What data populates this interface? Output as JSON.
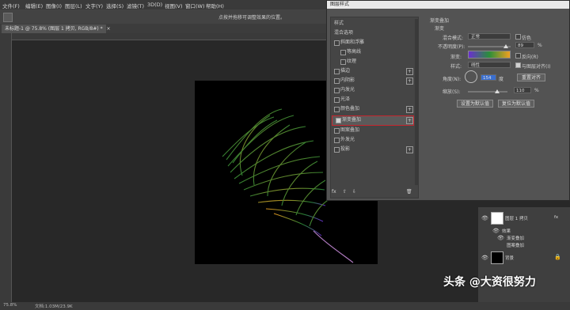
{
  "menubar": {
    "items": [
      "文件(F)",
      "编辑(E)",
      "图像(I)",
      "图层(L)",
      "文字(Y)",
      "选择(S)",
      "滤镜(T)",
      "3D(D)",
      "视图(V)",
      "窗口(W)",
      "帮助(H)"
    ]
  },
  "optionsbar": {
    "hint": "点按并拖移可调整效果的位置。"
  },
  "document": {
    "tab_title": "未标题-1 @ 75.8% (图层 1 拷贝, RGB/8#) *",
    "tab_close": "×"
  },
  "statusbar": {
    "zoom": "75.8%",
    "doc_info": "文档:1.03M/23.9K"
  },
  "dialog": {
    "title": "图层样式",
    "left_list": {
      "styles_label": "样式",
      "blend_label": "混合选项",
      "items": [
        {
          "label": "斜面和浮雕",
          "checked": false,
          "plus": ""
        },
        {
          "label": "等高线",
          "checked": false,
          "plus": ""
        },
        {
          "label": "纹理",
          "checked": false,
          "plus": ""
        },
        {
          "label": "描边",
          "checked": false,
          "plus": "+"
        },
        {
          "label": "内阴影",
          "checked": false,
          "plus": "+"
        },
        {
          "label": "内发光",
          "checked": false,
          "plus": ""
        },
        {
          "label": "光泽",
          "checked": false,
          "plus": ""
        },
        {
          "label": "颜色叠加",
          "checked": false,
          "plus": "+"
        },
        {
          "label": "渐变叠加",
          "checked": true,
          "plus": "+"
        },
        {
          "label": "图案叠加",
          "checked": false,
          "plus": ""
        },
        {
          "label": "外发光",
          "checked": false,
          "plus": ""
        },
        {
          "label": "投影",
          "checked": false,
          "plus": "+"
        }
      ],
      "footer_fx": "fx",
      "footer_up": "⇧",
      "footer_down": "⇩",
      "footer_trash": "🗑"
    },
    "panel": {
      "section_title": "渐变叠加",
      "subsection": "渐变",
      "blend_mode_label": "混合模式:",
      "blend_mode_value": "正常",
      "dither_label": "仿色",
      "opacity_label": "不透明度(P):",
      "opacity_value": "89",
      "opacity_unit": "%",
      "opacity_level": 0.89,
      "gradient_label": "渐变:",
      "reverse_label": "反向(R)",
      "style_label": "样式:",
      "style_value": "线性",
      "align_label": "与图层对齐(I)",
      "angle_label": "角度(N):",
      "angle_value": "154",
      "angle_unit": "度",
      "reset_align_button": "重置对齐",
      "scale_label": "缩放(S):",
      "scale_value": "110",
      "scale_unit": "%",
      "scale_level": 0.73,
      "default_button": "设置为默认值",
      "reset_default_button": "复位为默认值"
    }
  },
  "layers": {
    "rows": [
      {
        "name": "图层 1 拷贝",
        "fx": "fx"
      },
      {
        "name": "效果"
      },
      {
        "name": "渐变叠加"
      },
      {
        "name": "图案叠加"
      },
      {
        "name": "背景"
      }
    ]
  },
  "watermark": {
    "text": "头条 @大资很努力"
  },
  "colors": {
    "gradient": [
      "#6a2fd0",
      "#2a8f3a",
      "#f0a020"
    ],
    "selection_border": "#c6262e"
  }
}
